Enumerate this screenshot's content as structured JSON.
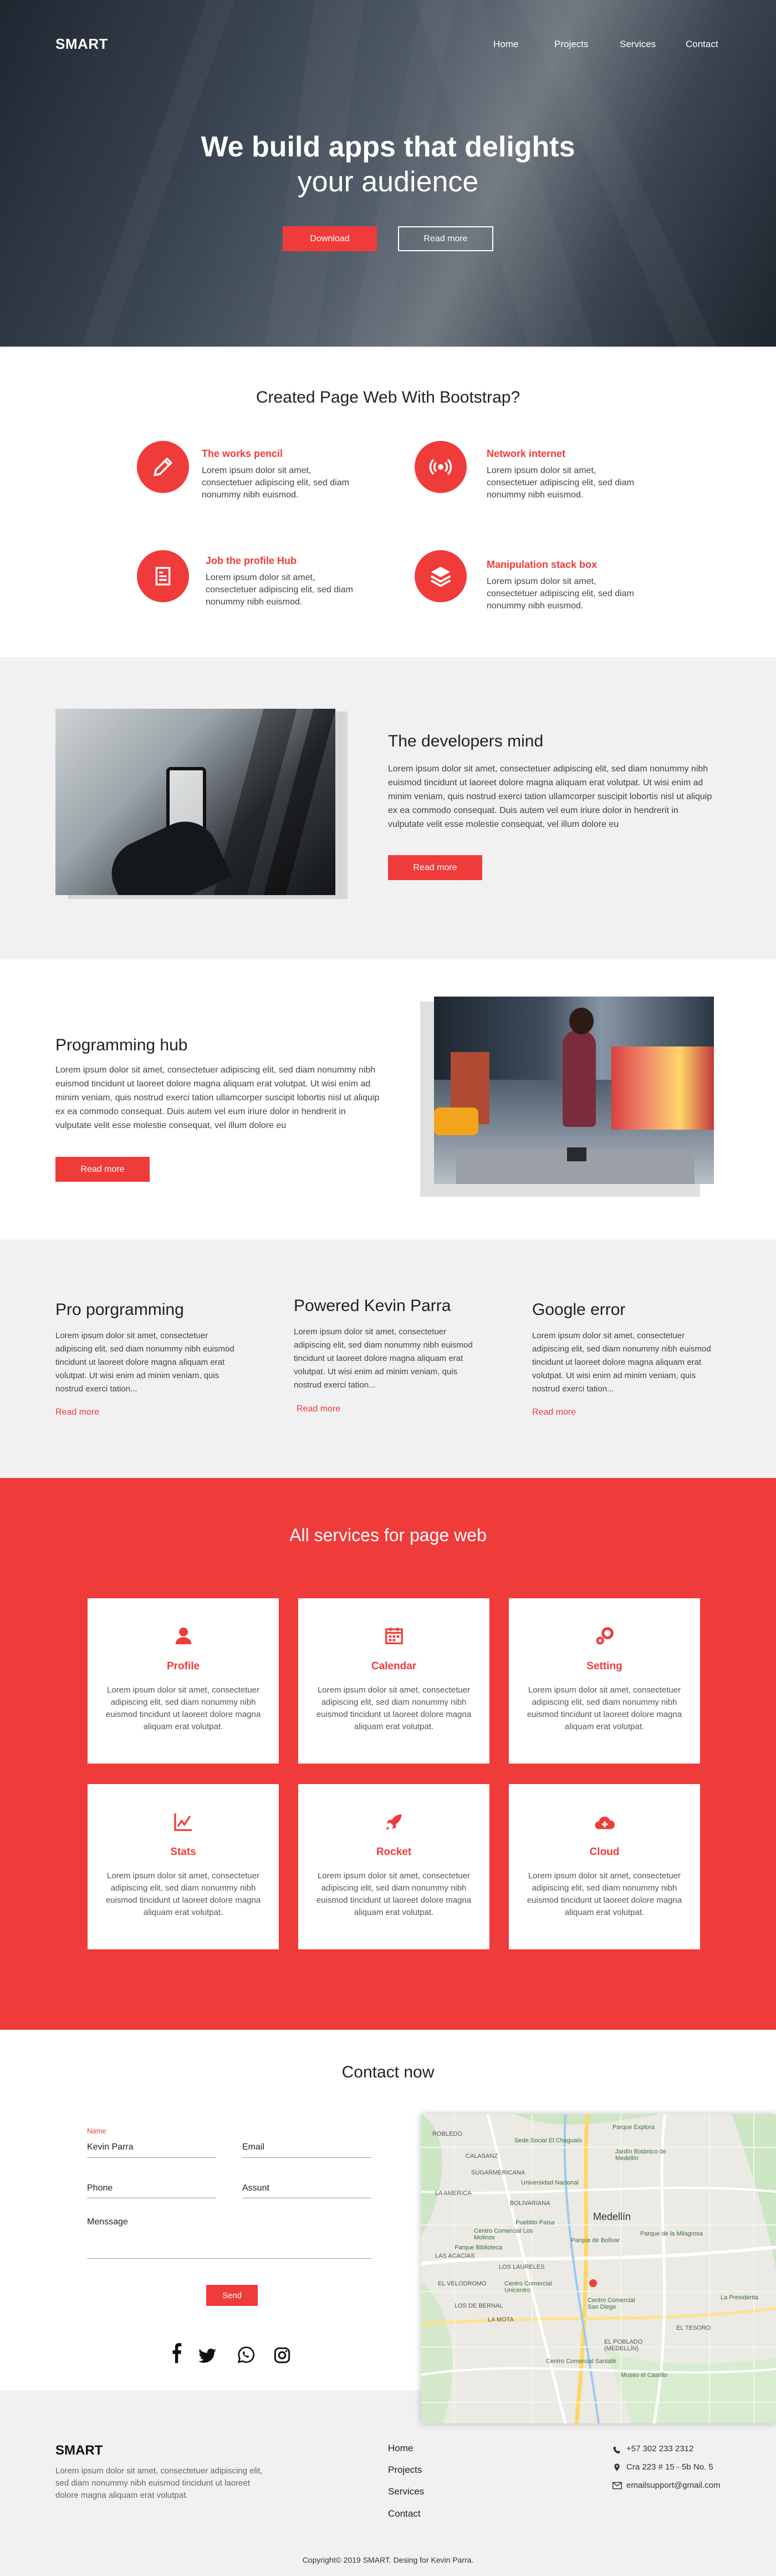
{
  "header": {
    "brand": "SMART",
    "nav": [
      "Home",
      "Projects",
      "Services",
      "Contact"
    ]
  },
  "hero": {
    "title_line1": "We build apps that delights",
    "title_line2": "your audience",
    "primary_button": "Download",
    "secondary_button": "Read more"
  },
  "features": {
    "title": "Created Page Web With Bootstrap?",
    "items": [
      {
        "title": "The works pencil",
        "text": "Lorem ipsum dolor sit amet, consectetuer adipiscing elit, sed diam nonummy nibh euismod.",
        "icon": "pencil-icon"
      },
      {
        "title": "Network internet",
        "text": "Lorem ipsum dolor sit amet, consectetuer adipiscing elit, sed diam nonummy nibh euismod.",
        "icon": "broadcast-icon"
      },
      {
        "title": "Job the profile Hub",
        "text": "Lorem ipsum dolor sit amet, consectetuer adipiscing elit, sed diam nonummy nibh euismod.",
        "icon": "document-icon"
      },
      {
        "title": "Manipulation stack box",
        "text": "Lorem ipsum dolor sit amet, consectetuer adipiscing elit, sed diam nonummy nibh euismod.",
        "icon": "layers-icon"
      }
    ]
  },
  "developers": {
    "title": "The developers mind",
    "text": "Lorem ipsum dolor sit amet, consectetuer adipiscing elit, sed diam nonummy nibh euismod tincidunt ut laoreet dolore magna aliquam erat volutpat. Ut wisi enim ad minim veniam, quis nostrud exerci tation ullamcorper suscipit lobortis nisl ut aliquip ex ea commodo consequat. Duis autem vel eum iriure dolor in hendrerit in vulputate velit esse molestie consequat, vel illum dolore eu",
    "button": "Read more"
  },
  "programming": {
    "title": "Programming hub",
    "text": "Lorem ipsum dolor sit amet, consectetuer adipiscing elit, sed diam nonummy nibh euismod tincidunt ut laoreet dolore magna aliquam erat volutpat. Ut wisi enim ad minim veniam, quis nostrud exerci tation ullamcorper suscipit lobortis nisl ut aliquip ex ea commodo consequat. Duis autem vel eum iriure dolor in hendrerit in vulputate velit esse molestie consequat, vel illum dolore eu",
    "button": "Read more"
  },
  "columns": [
    {
      "title": "Pro porgramming",
      "text": "Lorem ipsum dolor sit amet, consectetuer adipiscing elit, sed diam nonummy nibh euismod tincidunt ut laoreet dolore magna aliquam erat volutpat. Ut wisi enim ad minim veniam, quis nostrud exerci tation...",
      "link": "Read more"
    },
    {
      "title": "Powered Kevin Parra",
      "text": "Lorem ipsum dolor sit amet, consectetuer adipiscing elit, sed diam nonummy nibh euismod tincidunt ut laoreet dolore magna aliquam erat volutpat. Ut wisi enim ad minim veniam, quis nostrud exerci tation...",
      "link": "Read more"
    },
    {
      "title": "Google error",
      "text": "Lorem ipsum dolor sit amet, consectetuer adipiscing elit, sed diam nonummy nibh euismod tincidunt ut laoreet dolore magna aliquam erat volutpat. Ut wisi enim ad minim veniam, quis nostrud exerci tation...",
      "link": "Read more"
    }
  ],
  "services": {
    "title": "All services for page web",
    "cards": [
      {
        "title": "Profile",
        "icon": "user-icon",
        "text": "Lorem ipsum dolor sit amet, consectetuer adipiscing elit, sed diam nonummy nibh euismod tincidunt ut laoreet dolore magna aliquam erat volutpat."
      },
      {
        "title": "Calendar",
        "icon": "calendar-icon",
        "text": "Lorem ipsum dolor sit amet, consectetuer adipiscing elit, sed diam nonummy nibh euismod tincidunt ut laoreet dolore magna aliquam erat volutpat."
      },
      {
        "title": "Setting",
        "icon": "gears-icon",
        "text": "Lorem ipsum dolor sit amet, consectetuer adipiscing elit, sed diam nonummy nibh euismod tincidunt ut laoreet dolore magna aliquam erat volutpat."
      },
      {
        "title": "Stats",
        "icon": "chart-icon",
        "text": "Lorem ipsum dolor sit amet, consectetuer adipiscing elit, sed diam nonummy nibh euismod tincidunt ut laoreet dolore magna aliquam erat volutpat."
      },
      {
        "title": "Rocket",
        "icon": "rocket-icon",
        "text": "Lorem ipsum dolor sit amet, consectetuer adipiscing elit, sed diam nonummy nibh euismod tincidunt ut laoreet dolore magna aliquam erat volutpat."
      },
      {
        "title": "Cloud",
        "icon": "cloud-icon",
        "text": "Lorem ipsum dolor sit amet, consectetuer adipiscing elit, sed diam nonummy nibh euismod tincidunt ut laoreet dolore magna aliquam erat volutpat."
      }
    ]
  },
  "contact": {
    "title": "Contact now",
    "name_label": "Name",
    "name_value": "Kevin Parra",
    "email_placeholder": "Email",
    "phone_placeholder": "Phone",
    "subject_placeholder": "Assunt",
    "message_placeholder": "Menssage",
    "send_button": "Send",
    "social": [
      "facebook-icon",
      "twitter-icon",
      "whatsapp-icon",
      "instagram-icon"
    ]
  },
  "map": {
    "labels": [
      "Sede Social El Chagualo",
      "Parque Explora",
      "Jardín Botánico de Medellín",
      "SUGARMERICANA",
      "Universidad Nacional",
      "BOLIVARIANA",
      "Medellín",
      "Pueblito Paisa",
      "Parque de Bolívar",
      "Centro Comercial Los Molinos",
      "Parque de la Milagrosa",
      "Parque Biblioteca",
      "Centro Comercial Unicentro",
      "Centro Comercial San Diego",
      "EL POBLADO (MEDELLÍN)",
      "Centro Comercial Santafé",
      "Museo el Castillo",
      "LA AMERICA",
      "LAS ACACIAS",
      "LOS LAURELES",
      "LA MOTA",
      "LOS DE BERNAL",
      "CALASANZ",
      "EL TESORO",
      "La Presidenta",
      "ROBLEDO",
      "EL VELODROMO"
    ]
  },
  "footer": {
    "brand": "SMART",
    "text": "Lorem ipsum dolor sit amet, consectetuer adipiscing elit, sed diam nonummy nibh euismod tincidunt ut laoreet dolore magna aliquam erat volutpat.",
    "links": [
      "Home",
      "Projects",
      "Services",
      "Contact"
    ],
    "phone": "+57 302 233 2312",
    "address": "Cra 223 # 15 - 5b No. 5",
    "email": "emailsupport@gmail.com",
    "copyright": "Copyright© 2019 SMART. Desing for Kevin Parra."
  },
  "colors": {
    "accent": "#ef3b3a",
    "gray_bg": "#f1f1f1"
  }
}
